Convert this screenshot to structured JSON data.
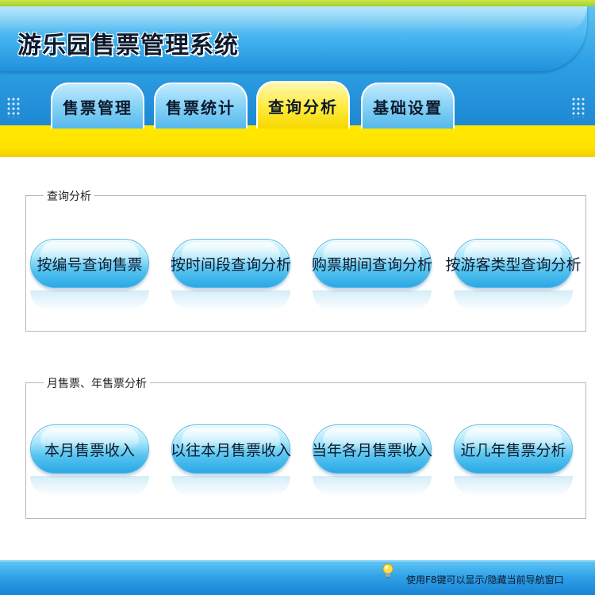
{
  "app": {
    "title": "游乐园售票管理系统"
  },
  "tabs": [
    {
      "label": "售票管理",
      "active": false
    },
    {
      "label": "售票统计",
      "active": false
    },
    {
      "label": "查询分析",
      "active": true
    },
    {
      "label": "基础设置",
      "active": false
    }
  ],
  "groups": [
    {
      "legend": "查询分析",
      "buttons": [
        "按编号查询售票",
        "按时间段查询分析",
        "购票期间查询分析",
        "按游客类型查询分析"
      ]
    },
    {
      "legend": "月售票、年售票分析",
      "buttons": [
        "本月售票收入",
        "以往本月售票收入",
        "当年各月售票收入",
        "近几年售票分析"
      ]
    }
  ],
  "footer": {
    "hint": "使用F8键可以显示/隐藏当前导航窗口"
  },
  "colors": {
    "header_blue": "#2ea0e5",
    "active_tab_yellow": "#ffea3a",
    "band_yellow": "#ffe900",
    "pill_blue": "#54c3ef"
  },
  "icons": {
    "footer_hint": "lightbulb-icon"
  }
}
